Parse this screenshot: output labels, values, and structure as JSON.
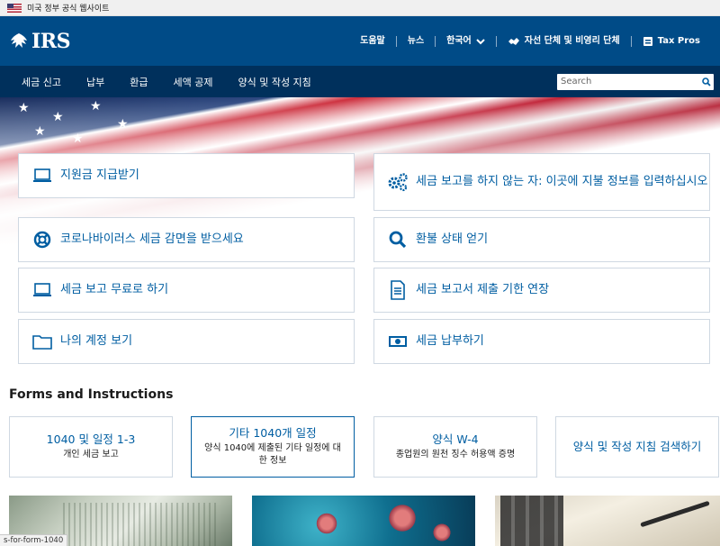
{
  "gov_banner": {
    "text": "미국 정부 공식 웹사이트"
  },
  "header": {
    "logo_text": "IRS",
    "links": [
      {
        "label": "도움말"
      },
      {
        "label": "뉴스"
      },
      {
        "label": "한국어"
      },
      {
        "label": "자선 단체 및 비영리 단체"
      },
      {
        "label": "Tax Pros"
      }
    ]
  },
  "nav": {
    "items": [
      "세금 신고",
      "납부",
      "환급",
      "세액 공제",
      "양식 및 작성 지침"
    ],
    "search_placeholder": "Search"
  },
  "actions": [
    {
      "label": "지원금 지급받기",
      "icon": "laptop-icon"
    },
    {
      "label": "세금 보고를 하지 않는 자: 이곳에 지불 정보를 입력하십시오",
      "icon": "gears-icon"
    },
    {
      "label": "코로나바이러스 세금 감면을 받으세요",
      "icon": "lifebuoy-icon"
    },
    {
      "label": "환불 상태 얻기",
      "icon": "search-icon"
    },
    {
      "label": "세금 보고 무료로 하기",
      "icon": "laptop-icon"
    },
    {
      "label": "세금 보고서 제출 기한 연장",
      "icon": "document-icon"
    },
    {
      "label": "나의 계정 보기",
      "icon": "folder-icon"
    },
    {
      "label": "세금 납부하기",
      "icon": "money-icon"
    }
  ],
  "forms": {
    "title": "Forms and Instructions",
    "items": [
      {
        "title": "1040 및 일정 1-3",
        "desc": "개인 세금 보고"
      },
      {
        "title": "기타 1040개 일정",
        "desc": "양식 1040에 제출된 기타 일정에 대한 정보"
      },
      {
        "title": "양식 W-4",
        "desc": "종업원의 원천 징수 허용액 증명"
      },
      {
        "title": "양식 및 작성 지침 검색하기",
        "desc": ""
      }
    ]
  },
  "status_url": "s-for-form-1040",
  "colors": {
    "header": "#004b87",
    "nav": "#00305c",
    "link": "#005ea2"
  }
}
